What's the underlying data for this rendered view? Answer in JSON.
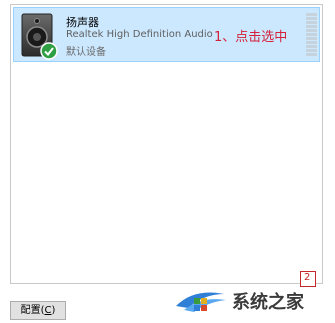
{
  "device": {
    "name": "扬声器",
    "driver": "Realtek High Definition Audio",
    "status": "默认设备",
    "icon": "speaker-icon",
    "badge_icon": "default-check-icon"
  },
  "annotation": "1、点击选中",
  "buttons": {
    "configure_label": "配置(",
    "configure_hotkey": "C",
    "configure_suffix": ")"
  },
  "watermark": {
    "text": "系统之家"
  },
  "colors": {
    "selection_bg": "#cce8ff",
    "selection_border": "#99d1ff",
    "annotation": "#d4203a",
    "check_green": "#2ea043"
  }
}
